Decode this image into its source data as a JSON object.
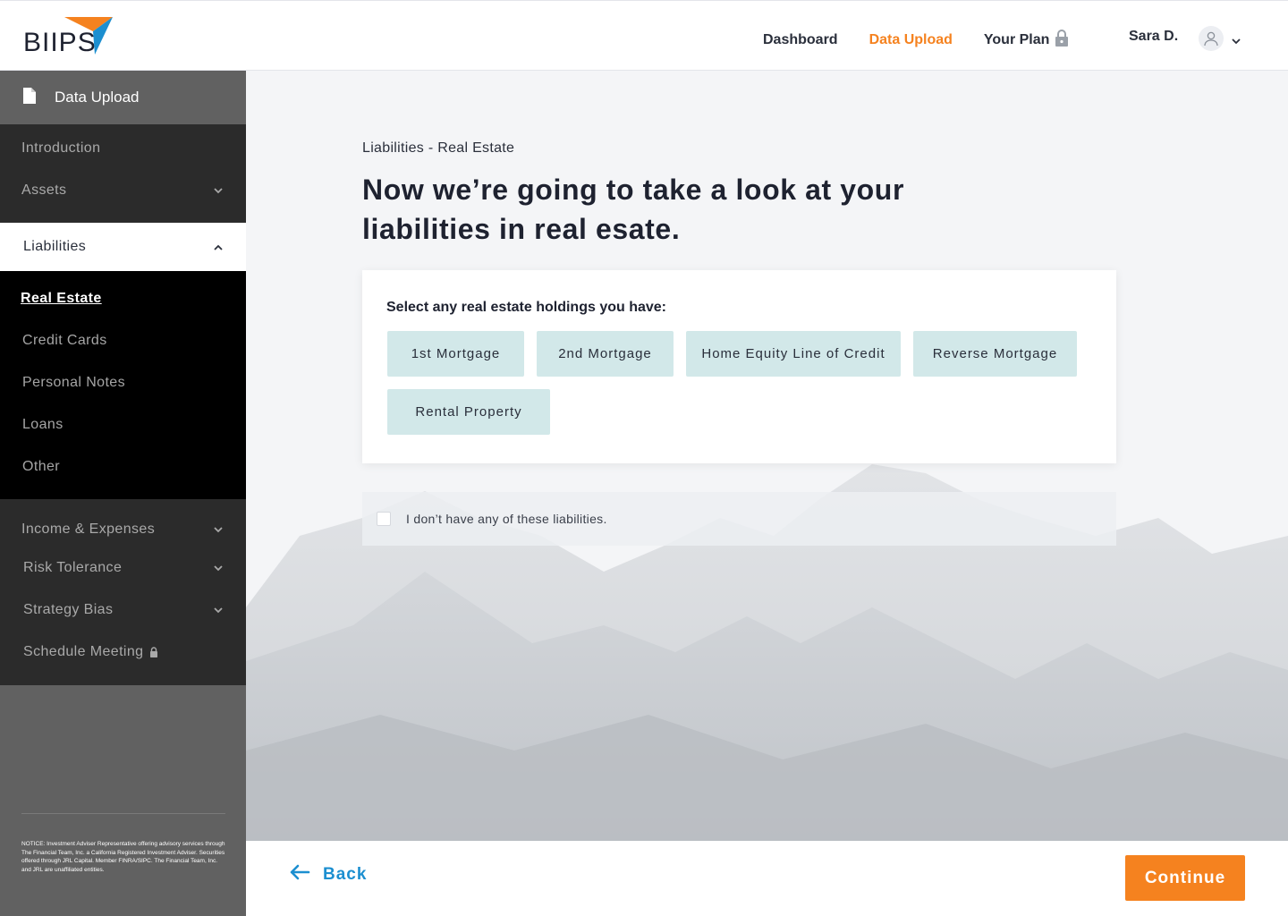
{
  "header": {
    "logo_text": "BIIPS",
    "nav": [
      {
        "label": "Dashboard",
        "icon": null
      },
      {
        "label": "Data Upload",
        "icon": null
      },
      {
        "label": "Your Plan",
        "icon": "lock-icon"
      }
    ],
    "active_nav": "Data Upload",
    "user_name": "Sara D.",
    "user_icon": "user-icon",
    "user_menu_icon": "chevron-down-icon"
  },
  "sidebar": {
    "section_title": "Data Upload",
    "section_icon": "document-icon",
    "items": [
      {
        "label": "Introduction"
      },
      {
        "label": "Assets",
        "icon": "chevron-down-icon"
      },
      {
        "label": "Liabilities",
        "icon": "chevron-up-icon",
        "expanded": true
      },
      {
        "label": "Income & Expenses",
        "icon": "chevron-down-icon"
      },
      {
        "label": "Risk Tolerance",
        "icon": "chevron-down-icon"
      },
      {
        "label": "Strategy Bias",
        "icon": "chevron-down-icon"
      },
      {
        "label": "Schedule Meeting",
        "icon": "lock-icon"
      }
    ],
    "liabilities_sub": [
      {
        "label": "Real Estate",
        "active": true
      },
      {
        "label": "Credit Cards"
      },
      {
        "label": "Personal Notes"
      },
      {
        "label": "Loans"
      },
      {
        "label": "Other"
      }
    ],
    "notice": "NOTICE: Investment Adviser Representative offering advisory services through The Financial Team, Inc. a California Registered Investment Adviser. Securities offered through JRL Capital. Member FINRA/SIPC. The Financial Team, Inc. and JRL are unaffiliated entities."
  },
  "main": {
    "breadcrumb": "Liabilities - Real Estate",
    "title": "Now we’re going to take a look at your liabilities in real esate.",
    "card_label": "Select any real estate holdings  you have:",
    "options": [
      "1st Mortgage",
      "2nd Mortgage",
      "Home Equity Line of Credit",
      "Reverse Mortgage",
      "Rental Property"
    ],
    "none_label": "I don’t have any of these liabilities.",
    "none_checked": false
  },
  "footer": {
    "back_label": "Back",
    "back_icon": "arrow-left-icon",
    "continue_label": "Continue"
  },
  "colors": {
    "accent": "#f5821f",
    "link": "#1c8fd0",
    "chip": "#d2e8e9",
    "sidebar_dark": "#2b2b2b",
    "sidebar_black": "#000000",
    "sidebar_gray": "#616161"
  }
}
